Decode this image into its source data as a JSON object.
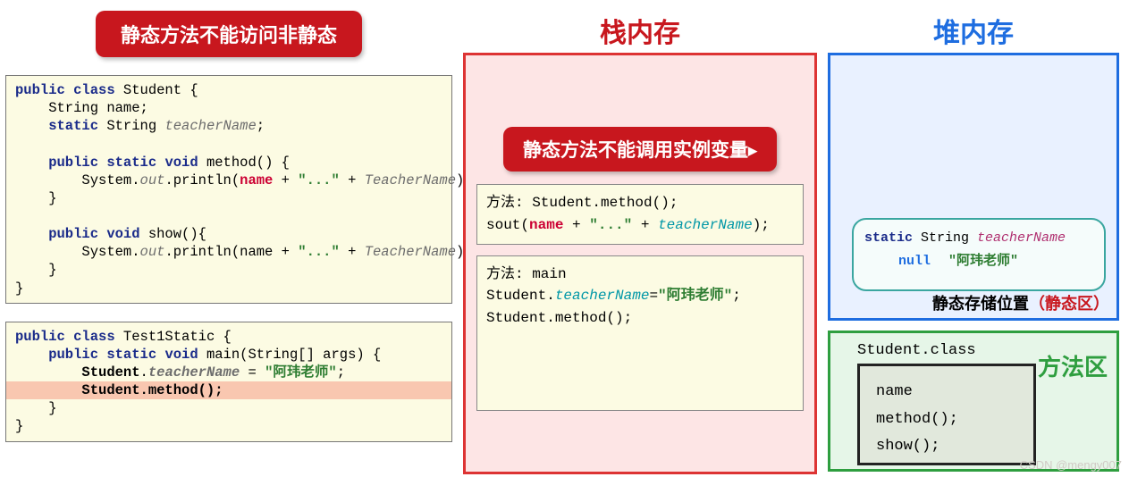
{
  "topBadge": "静态方法不能访问非静态",
  "code1": {
    "l1a": "public",
    "l1b": " class",
    "l1c": " Student {",
    "l2a": "    String name;",
    "l3a": "    static",
    "l3b": " String ",
    "l3c": "teacherName",
    "l3d": ";",
    "l5a": "    public",
    "l5b": " static",
    "l5c": " void",
    "l5d": " method() {",
    "l6a": "        System.",
    "l6b": "out",
    "l6c": ".println(",
    "l6d": "name",
    "l6e": " + ",
    "l6f": "\"...\"",
    "l6g": " + ",
    "l6h": "TeacherName",
    "l6i": ");",
    "l7a": "    }",
    "l9a": "    public",
    "l9b": " void",
    "l9c": " show(){",
    "l10a": "        System.",
    "l10b": "out",
    "l10c": ".println(name + ",
    "l10d": "\"...\"",
    "l10e": " + ",
    "l10f": "TeacherName",
    "l10g": ");",
    "l11a": "    }",
    "l12a": "}"
  },
  "code2": {
    "l1a": "public",
    "l1b": " class",
    "l1c": " Test1Static {",
    "l2a": "    public",
    "l2b": " static",
    "l2c": " void",
    "l2d": " main(String[] args) {",
    "l3a": "        Student",
    "l3b": ".",
    "l3c": "teacherName",
    "l3d": " = ",
    "l3e": "\"阿玮老师\"",
    "l3f": ";",
    "l4a": "        Student.method();",
    "l5a": "    }",
    "l6a": "}"
  },
  "stackTitle": "栈内存",
  "stackBadge": "静态方法不能调用实例变量",
  "frame1": {
    "l1": "方法: Student.method();",
    "l2a": "sout(",
    "l2b": "name",
    "l2c": " + ",
    "l2d": "\"...\"",
    "l2e": " + ",
    "l2f": "teacherName",
    "l2g": ");"
  },
  "frame2": {
    "l1": "方法: main",
    "l2a": "Student.",
    "l2b": "teacherName",
    "l2c": "=",
    "l2d": "\"阿玮老师\"",
    "l2e": ";",
    "l3": "Student.method();"
  },
  "heapTitle": "堆内存",
  "staticBox": {
    "kw": "static",
    "type": " String ",
    "var": "teacherName",
    "nullTxt": "null",
    "val": "\"阿玮老师\""
  },
  "staticLabel1": "静态存储位置",
  "staticLabel2": "（静态区）",
  "methodTitle": "方法区",
  "classLabel": "Student.class",
  "classBox": {
    "l1": "name",
    "l2": "method();",
    "l3": "show();"
  },
  "watermark": "CSDN @mengy007",
  "cursor": "▶"
}
